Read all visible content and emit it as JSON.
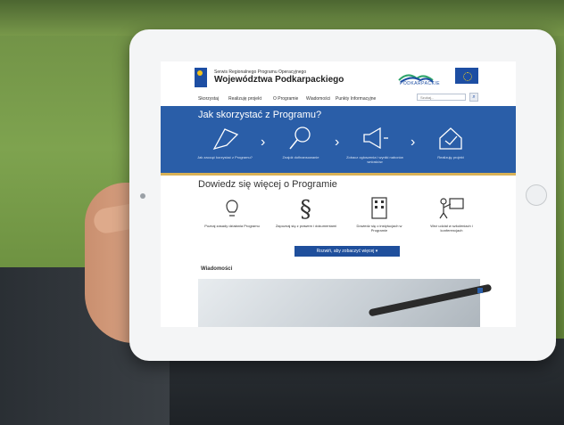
{
  "site": {
    "brand_sub": "Serwis Regionalnego Programu Operacyjnego",
    "brand_main": "Województwa Podkarpackiego",
    "partner": "PODKARPACKIE"
  },
  "nav": {
    "items": [
      "Skorzystaj",
      "Realizuję projekt",
      "O Programie",
      "Wiadomości",
      "Punkty Informacyjne"
    ],
    "search_placeholder": "Szukaj..."
  },
  "hero": {
    "title": "Jak skorzystać z Programu?",
    "steps": [
      {
        "label": "Jak zacząć korzystać z Programu?",
        "icon": "flag-icon"
      },
      {
        "label": "Znajdź dofinansowanie",
        "icon": "magnifier-icon"
      },
      {
        "label": "Zobacz ogłoszenia i wyniki naborów wniosków",
        "icon": "megaphone-icon"
      },
      {
        "label": "Realizuję projekt",
        "icon": "house-check-icon"
      }
    ]
  },
  "learn": {
    "title": "Dowiedz się więcej o Programie",
    "cards": [
      {
        "label": "Poznaj zasady działania Programu",
        "icon": "bulb-icon"
      },
      {
        "label": "Zapoznaj się z prawem i dokumentami",
        "icon": "paragraph-icon"
      },
      {
        "label": "Dowiedz się o instytucjach w Programie",
        "icon": "building-icon"
      },
      {
        "label": "Weź udział w szkoleniach i konferencjach",
        "icon": "presentation-icon"
      }
    ],
    "cta": "Rozwiń, aby zobaczyć więcej"
  },
  "news": {
    "title": "Wiadomości"
  }
}
